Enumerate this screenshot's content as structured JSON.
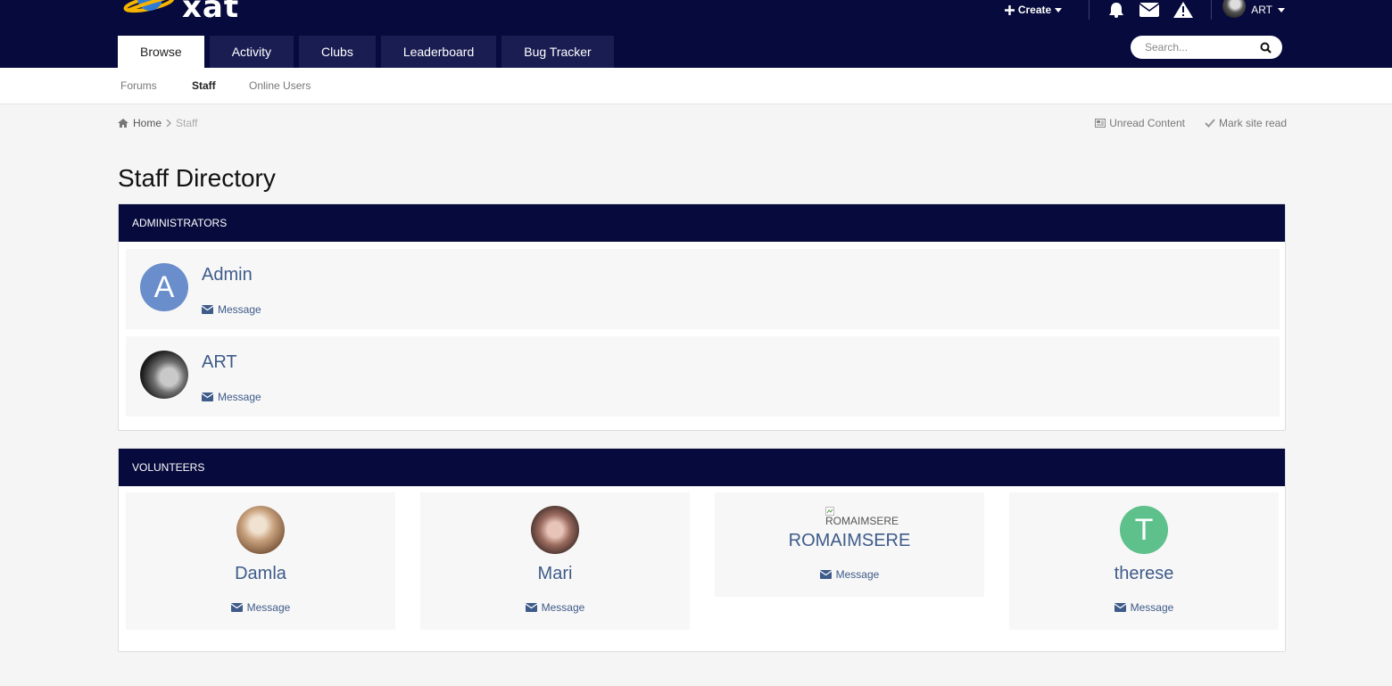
{
  "brand": {
    "logo_text": "xat"
  },
  "nav": {
    "tabs": [
      "Browse",
      "Activity",
      "Clubs",
      "Leaderboard",
      "Bug Tracker"
    ],
    "active_tab": "Browse"
  },
  "userbar": {
    "create_label": "Create",
    "username": "ART"
  },
  "search": {
    "placeholder": "Search..."
  },
  "subnav": {
    "items": [
      "Forums",
      "Staff",
      "Online Users"
    ],
    "active": "Staff"
  },
  "breadcrumb": {
    "home": "Home",
    "current": "Staff"
  },
  "breadcrumb_actions": {
    "unread": "Unread Content",
    "mark_read": "Mark site read"
  },
  "page_title": "Staff Directory",
  "administrators": {
    "title": "ADMINISTRATORS",
    "members": [
      {
        "name": "Admin",
        "avatar_letter": "A",
        "avatar_color": "#6a8ecb",
        "message_label": "Message"
      },
      {
        "name": "ART",
        "avatar_letter": "",
        "avatar_color": "#2a2a2a",
        "message_label": "Message"
      }
    ]
  },
  "volunteers": {
    "title": "VOLUNTEERS",
    "members": [
      {
        "name": "Damla",
        "avatar_letter": "",
        "avatar_color": "#c9b39a",
        "message_label": "Message"
      },
      {
        "name": "Mari",
        "avatar_letter": "",
        "avatar_color": "#8a6a60",
        "message_label": "Message"
      },
      {
        "name": "ROMAIMSERE",
        "broken_image_alt": "ROMAIMSERE",
        "message_label": "Message"
      },
      {
        "name": "therese",
        "avatar_letter": "T",
        "avatar_color": "#5ec08b",
        "message_label": "Message"
      }
    ]
  },
  "colors": {
    "header_bg": "#070a3c",
    "link": "#3e5b8a",
    "tab_bg": "#1a1d52"
  }
}
